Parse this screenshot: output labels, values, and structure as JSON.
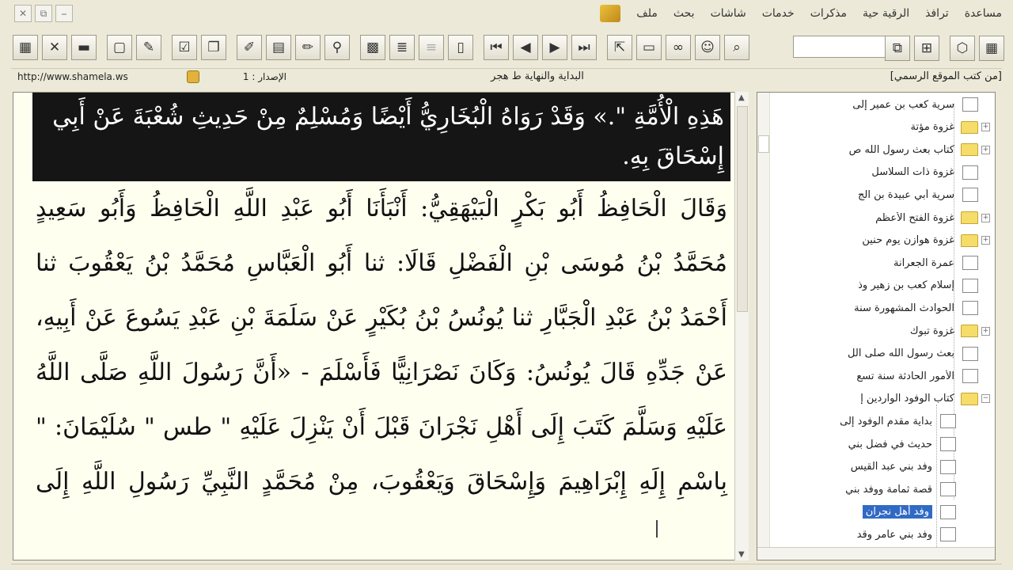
{
  "window": {
    "buttons": [
      {
        "name": "close",
        "glyph": "✕"
      },
      {
        "name": "restore",
        "glyph": "⧉"
      },
      {
        "name": "minimize",
        "glyph": "⎯"
      }
    ]
  },
  "menu": {
    "items": [
      "ملف",
      "بحث",
      "شاشات",
      "خدمات",
      "مذكرات",
      "الرقية حية",
      "ترافذ",
      "مساعدة"
    ]
  },
  "toolbar": {
    "icons": [
      "app-logo-icon",
      "tools-icon",
      "book-icon",
      "page-icon",
      "browse-icon",
      "check-icon",
      "copy-icon",
      "edit-icon",
      "highlight-icon",
      "pencil-icon",
      "filter-icon",
      "grid-icon",
      "notes-icon",
      "blank-icon",
      "open-book-icon",
      "first-page-icon",
      "prev-page-icon",
      "next-page-icon",
      "last-page-icon",
      "export-icon",
      "open-folder-icon",
      "binoculars-icon",
      "scholar-icon",
      "search-doc-icon",
      "new-window-icon",
      "tree-icon",
      "library-icon",
      "shelf-icon"
    ]
  },
  "addressbar": {
    "url": "http://www.shamela.ws",
    "edition": "الإصدار : 1",
    "book_title": "البداية والنهاية ط هجر",
    "source": "[من كتب الموقع الرسمي]"
  },
  "text": {
    "highlight_line1": "هَذِهِ الْأُمَّةِ \".» وَقَدْ رَوَاهُ الْبُخَارِيُّ أَيْضًا وَمُسْلِمٌ مِنْ حَدِيثِ شُعْبَةَ عَنْ أَبِي",
    "highlight_line2": "إِسْحَاقَ بِهِ.",
    "lines": [
      "وَقَالَ الْحَافِظُ أَبُو بَكْرٍ الْبَيْهَقِيُّ: أَنْبَأَنَا أَبُو عَبْدِ اللَّهِ الْحَافِظُ وَأَبُو سَعِيدٍ",
      "مُحَمَّدُ بْنُ مُوسَى بْنِ الْفَضْلِ قَالَا: ثنا أَبُو الْعَبَّاسِ مُحَمَّدُ بْنُ يَعْقُوبَ ثنا",
      "أَحْمَدُ بْنُ عَبْدِ الْجَبَّارِ ثنا يُونُسُ بْنُ بُكَيْرٍ عَنْ سَلَمَةَ بْنِ عَبْدِ يَسُوعَ عَنْ أَبِيهِ،",
      "عَنْ جَدِّهِ قَالَ يُونُسُ: وَكَانَ نَصْرَانِيًّا فَأَسْلَمَ - «أَنَّ رَسُولَ اللَّهِ صَلَّى اللَّهُ",
      "عَلَيْهِ وَسَلَّمَ كَتَبَ إِلَى أَهْلِ نَجْرَانَ قَبْلَ أَنْ يَنْزِلَ عَلَيْهِ \" طس \" سُلَيْمَانَ: \"",
      "بِاسْمِ إِلَهِ إِبْرَاهِيمَ وَإِسْحَاقَ وَيَعْقُوبَ، مِنْ مُحَمَّدٍ النَّبِيِّ رَسُولِ اللَّهِ إِلَى"
    ]
  },
  "tree": {
    "items": [
      {
        "label": "سرية كعب بن عمير إلى",
        "type": "box",
        "level": 0,
        "expander": ""
      },
      {
        "label": "غزوة مؤتة",
        "type": "folder",
        "level": 0,
        "expander": "+"
      },
      {
        "label": "كتاب بعث رسول الله ص",
        "type": "folder",
        "level": 0,
        "expander": "+"
      },
      {
        "label": "غزوة ذات السلاسل",
        "type": "box",
        "level": 0,
        "expander": ""
      },
      {
        "label": "سرية أبي عبيدة بن الج",
        "type": "box",
        "level": 0,
        "expander": ""
      },
      {
        "label": "غزوة الفتح الأعظم",
        "type": "folder",
        "level": 0,
        "expander": "+"
      },
      {
        "label": "غزوة هوازن يوم حنين",
        "type": "folder",
        "level": 0,
        "expander": "+"
      },
      {
        "label": "عمرة الجعرانة",
        "type": "box",
        "level": 0,
        "expander": ""
      },
      {
        "label": "إسلام كعب بن زهير وذ",
        "type": "box",
        "level": 0,
        "expander": ""
      },
      {
        "label": "الحوادث المشهورة سنة",
        "type": "box",
        "level": 0,
        "expander": ""
      },
      {
        "label": "غزوة تبوك",
        "type": "folder",
        "level": 0,
        "expander": "+"
      },
      {
        "label": "بعث رسول الله صلى الل",
        "type": "box",
        "level": 0,
        "expander": ""
      },
      {
        "label": "الأمور الحادثة سنة تسع",
        "type": "box",
        "level": 0,
        "expander": ""
      },
      {
        "label": "كتاب الوفود الواردين إ",
        "type": "folder",
        "level": 0,
        "expander": "−"
      },
      {
        "label": "بداية مقدم الوفود إلى",
        "type": "box",
        "level": 1,
        "expander": ""
      },
      {
        "label": "حديث في فضل بني",
        "type": "box",
        "level": 1,
        "expander": ""
      },
      {
        "label": "وفد بني عبد القيس",
        "type": "box",
        "level": 1,
        "expander": ""
      },
      {
        "label": "قصة ثمامة ووفد بني",
        "type": "box",
        "level": 1,
        "expander": ""
      },
      {
        "label": "وفد أهل نجران",
        "type": "box",
        "level": 1,
        "expander": "",
        "selected": true
      },
      {
        "label": "وفد بني عامر وقد",
        "type": "box",
        "level": 1,
        "expander": ""
      }
    ]
  }
}
